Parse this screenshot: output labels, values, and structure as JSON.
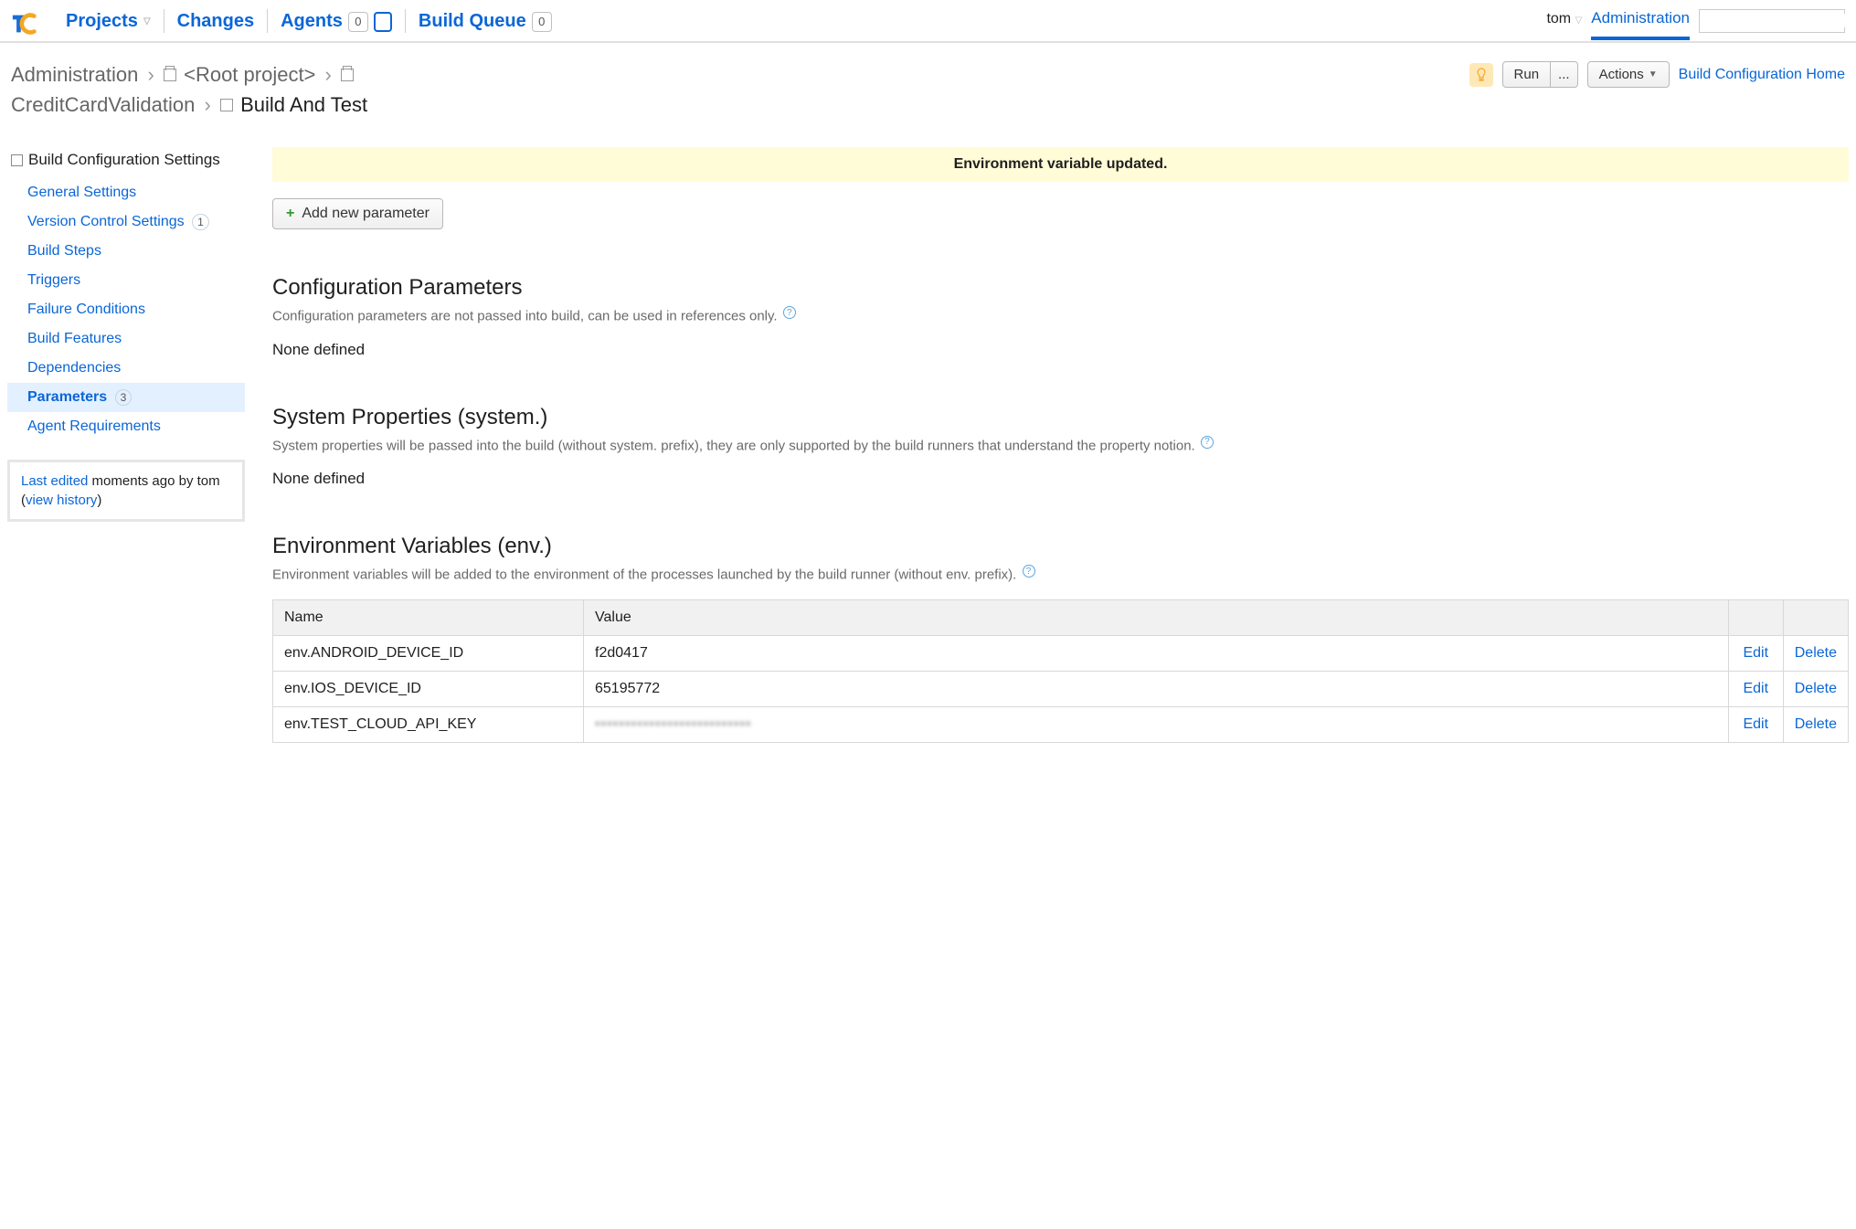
{
  "nav": {
    "projects": "Projects",
    "changes": "Changes",
    "agents": "Agents",
    "agents_count": "0",
    "build_queue": "Build Queue",
    "build_queue_count": "0",
    "user": "tom",
    "administration": "Administration"
  },
  "breadcrumb": {
    "admin": "Administration",
    "root": "<Root project>",
    "project": "CreditCardValidation",
    "build": "Build And Test"
  },
  "actions": {
    "run": "Run",
    "more": "...",
    "actions": "Actions",
    "home": "Build Configuration Home"
  },
  "sidebar": {
    "title": "Build Configuration Settings",
    "items": [
      {
        "label": "General Settings"
      },
      {
        "label": "Version Control Settings",
        "badge": "1"
      },
      {
        "label": "Build Steps"
      },
      {
        "label": "Triggers"
      },
      {
        "label": "Failure Conditions"
      },
      {
        "label": "Build Features"
      },
      {
        "label": "Dependencies"
      },
      {
        "label": "Parameters",
        "badge": "3",
        "active": true
      },
      {
        "label": "Agent Requirements"
      }
    ],
    "last_edited_prefix": "Last edited",
    "last_edited_when": " moments ago by tom (",
    "last_edited_link": "view history",
    "last_edited_suffix": ")"
  },
  "main": {
    "notice": "Environment variable updated.",
    "add_new": "Add new parameter",
    "config_params": {
      "title": "Configuration Parameters",
      "desc": "Configuration parameters are not passed into build, can be used in references only.",
      "none": "None defined"
    },
    "system_props": {
      "title": "System Properties (system.)",
      "desc": "System properties will be passed into the build (without system. prefix), they are only supported by the build runners that understand the property notion.",
      "none": "None defined"
    },
    "env_vars": {
      "title": "Environment Variables (env.)",
      "desc": "Environment variables will be added to the environment of the processes launched by the build runner (without env. prefix).",
      "columns": {
        "name": "Name",
        "value": "Value"
      },
      "rows": [
        {
          "name": "env.ANDROID_DEVICE_ID",
          "value": "f2d0417"
        },
        {
          "name": "env.IOS_DEVICE_ID",
          "value": "65195772"
        },
        {
          "name": "env.TEST_CLOUD_API_KEY",
          "value": "••••••••••••••••••••••••••",
          "secure": true
        }
      ],
      "edit": "Edit",
      "delete": "Delete"
    }
  }
}
